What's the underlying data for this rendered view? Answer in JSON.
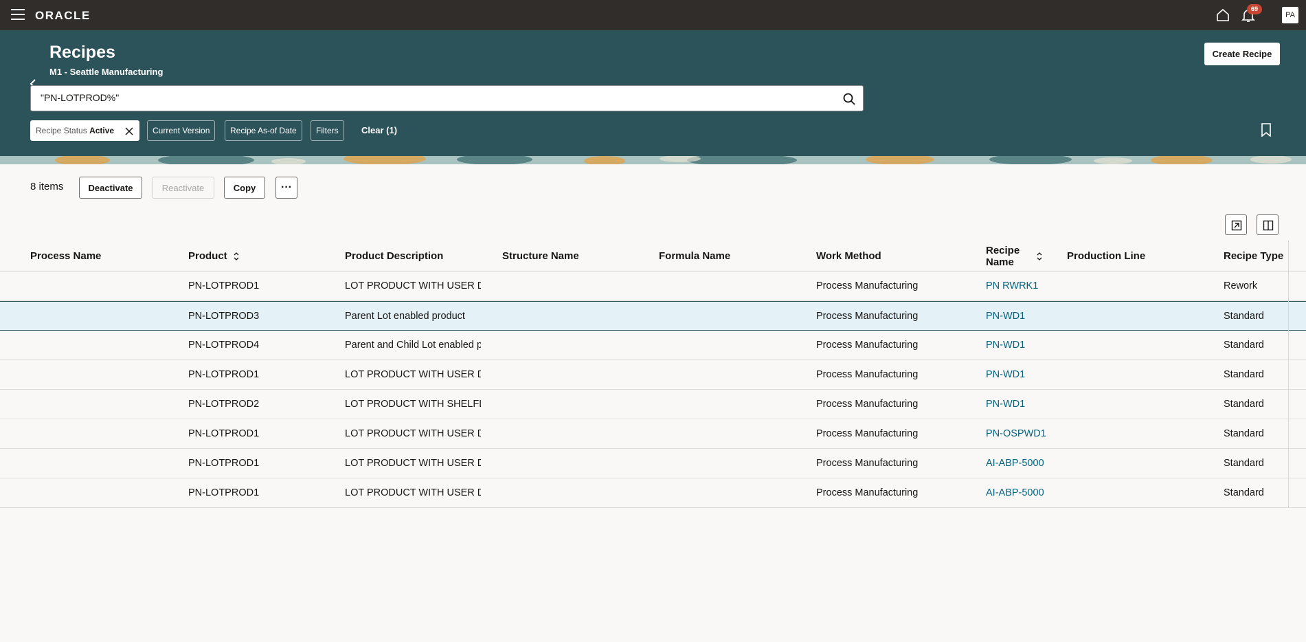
{
  "topbar": {
    "logo": "ORACLE",
    "notification_count": "69",
    "avatar_initials": "PA"
  },
  "header": {
    "title": "Recipes",
    "subtitle": "M1 - Seattle Manufacturing",
    "create_label": "Create Recipe",
    "search_value": "\"PN-LOTPROD%\"",
    "filters": {
      "status_label": "Recipe Status",
      "status_value": "Active",
      "current_version": "Current Version",
      "as_of_date": "Recipe As-of Date",
      "filters": "Filters",
      "clear": "Clear (1)"
    },
    "colors": {
      "bg": "#2c525a",
      "topbar": "#312d2a"
    }
  },
  "toolbar": {
    "item_count": "8 items",
    "deactivate": "Deactivate",
    "reactivate": "Reactivate",
    "copy": "Copy",
    "more": "···"
  },
  "table": {
    "columns": {
      "process_name": "Process Name",
      "product": "Product",
      "product_description": "Product Description",
      "structure_name": "Structure Name",
      "formula_name": "Formula Name",
      "work_method": "Work Method",
      "recipe_name_1": "Recipe",
      "recipe_name_2": "Name",
      "production_line": "Production Line",
      "recipe_type": "Recipe Type"
    },
    "rows": [
      {
        "process": "",
        "product": "PN-LOTPROD1",
        "description": "LOT PRODUCT WITH USER DE",
        "structure": "",
        "formula": "",
        "method": "Process Manufacturing",
        "recipe": "PN RWRK1",
        "line": "",
        "type": "Rework"
      },
      {
        "process": "",
        "product": "PN-LOTPROD3",
        "description": "Parent Lot enabled product",
        "structure": "",
        "formula": "",
        "method": "Process Manufacturing",
        "recipe": "PN-WD1",
        "line": "",
        "type": "Standard"
      },
      {
        "process": "",
        "product": "PN-LOTPROD4",
        "description": "Parent and Child Lot enabled p",
        "structure": "",
        "formula": "",
        "method": "Process Manufacturing",
        "recipe": "PN-WD1",
        "line": "",
        "type": "Standard"
      },
      {
        "process": "",
        "product": "PN-LOTPROD1",
        "description": "LOT PRODUCT WITH USER DE",
        "structure": "",
        "formula": "",
        "method": "Process Manufacturing",
        "recipe": "PN-WD1",
        "line": "",
        "type": "Standard"
      },
      {
        "process": "",
        "product": "PN-LOTPROD2",
        "description": "LOT PRODUCT WITH SHELFLI",
        "structure": "",
        "formula": "",
        "method": "Process Manufacturing",
        "recipe": "PN-WD1",
        "line": "",
        "type": "Standard"
      },
      {
        "process": "",
        "product": "PN-LOTPROD1",
        "description": "LOT PRODUCT WITH USER DE",
        "structure": "",
        "formula": "",
        "method": "Process Manufacturing",
        "recipe": "PN-OSPWD1",
        "line": "",
        "type": "Standard"
      },
      {
        "process": "",
        "product": "PN-LOTPROD1",
        "description": "LOT PRODUCT WITH USER DE",
        "structure": "",
        "formula": "",
        "method": "Process Manufacturing",
        "recipe": "AI-ABP-5000",
        "line": "",
        "type": "Standard"
      },
      {
        "process": "",
        "product": "PN-LOTPROD1",
        "description": "LOT PRODUCT WITH USER DE",
        "structure": "",
        "formula": "",
        "method": "Process Manufacturing",
        "recipe": "AI-ABP-5000",
        "line": "",
        "type": "Standard"
      }
    ],
    "selected_row": 1
  }
}
